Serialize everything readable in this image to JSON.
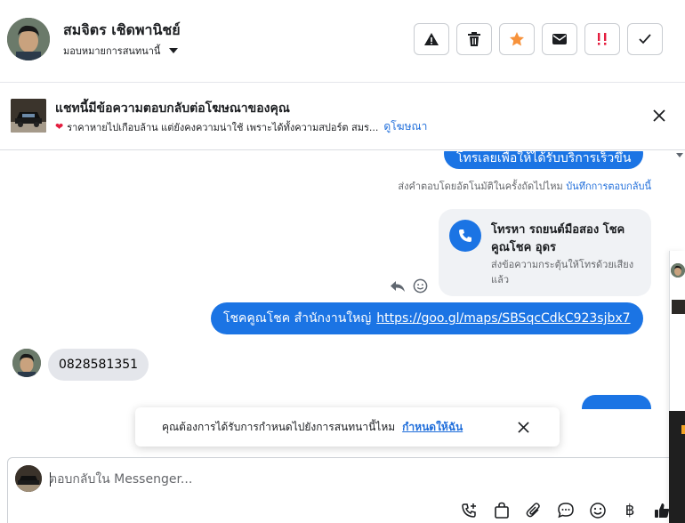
{
  "header": {
    "name": "สมจิตร เชิดพานิชย์",
    "assign_label": "มอบหมายการสนทนานี้",
    "actions": [
      {
        "icon": "warning-icon"
      },
      {
        "icon": "trash-icon"
      },
      {
        "icon": "star-icon",
        "color": "#f7923b"
      },
      {
        "icon": "mail-icon"
      },
      {
        "icon": "priority-icon",
        "color": "#e41e3f"
      },
      {
        "icon": "check-icon"
      }
    ]
  },
  "banner": {
    "title": "แชทนี้มีข้อความตอบกลับต่อโฆษณาของคุณ",
    "description": "ราคาหายไปเกือบล้าน แต่ยังคงความน่าใช้ เพราะได้ทั้งความสปอร์ต สมร...",
    "link": "ดูโฆษณา"
  },
  "conversation": {
    "top_bubble": "โทรเลยเพื่อให้ได้รับบริการเร็วขึ้น",
    "auto_reply_text": "ส่งคำตอบโดยอัตโนมัติในครั้งถัดไปไหม",
    "auto_reply_link": "บันทึกการตอบกลับนี้",
    "call_card": {
      "title": "โทรหา รถยนต์มือสอง โชคคูณโชค อุดร",
      "subtitle": "ส่งข้อความกระตุ้นให้โทรด้วยเสียงแล้ว"
    },
    "link_bubble": {
      "text": "โชคคูณโชค สำนักงานใหญ่",
      "url": "https://goo.gl/maps/SBSqcCdkC923sjbx7"
    },
    "incoming": "0828581351"
  },
  "toast": {
    "text": "คุณต้องการได้รับการกำหนดไปยังการสนทนานี้ไหม",
    "link": "กำหนดให้ฉัน"
  },
  "composer": {
    "placeholder": "ตอบกลับใน Messenger...",
    "currency_symbol": "฿",
    "tools": [
      "call-plus-icon",
      "bag-icon",
      "attachment-icon",
      "chat-bubble-icon",
      "emoji-icon",
      "baht-icon",
      "thumbs-up-icon"
    ]
  },
  "colors": {
    "accent": "#1b74e4",
    "link": "#216fdb",
    "incoming_bubble": "#e4e6eb"
  }
}
